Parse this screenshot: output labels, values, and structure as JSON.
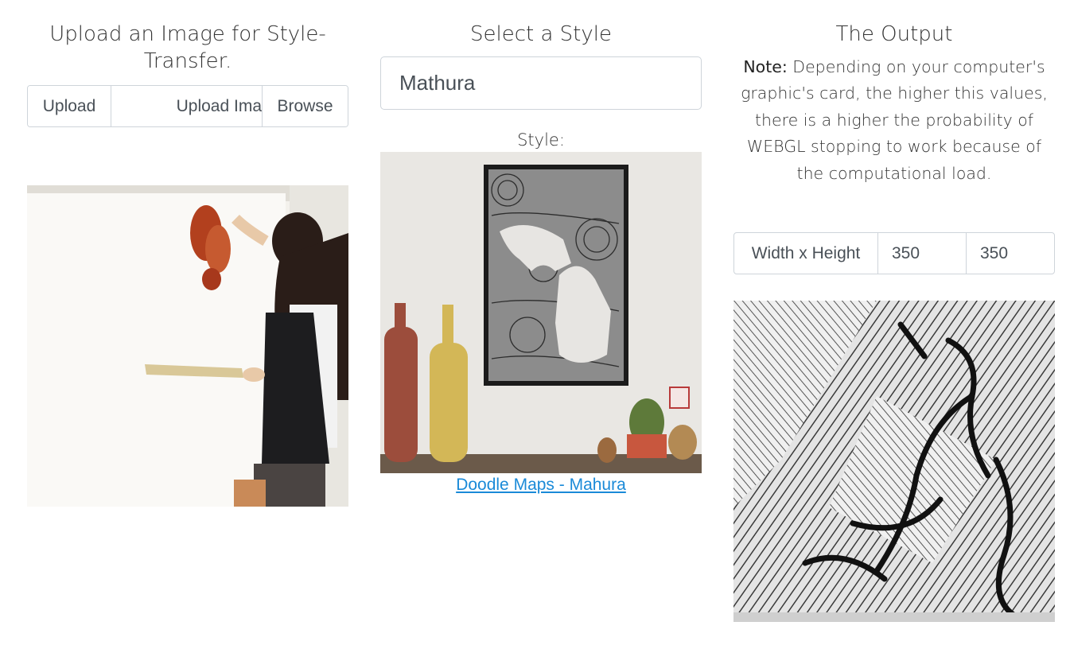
{
  "upload_column": {
    "title": "Upload an Image for Style-Transfer.",
    "prefix_label": "Upload",
    "file_placeholder": "Upload Ima",
    "browse_label": "Browse",
    "image_icon": "woman-painting-photo"
  },
  "style_column": {
    "title": "Select a Style",
    "selected_style": "Mathura",
    "style_label": "Style:",
    "style_image_icon": "doodle-map-photo",
    "link_text": "Doodle Maps - Mahura"
  },
  "output_column": {
    "title": "The Output",
    "note_bold": "Note:",
    "note_text": " Depending on your computer's graphic's card, the higher this values, there is a higher the probability of WEBGL stopping to work because of the computational load.",
    "size_label": "Width x Height",
    "width_value": "350",
    "height_value": "350",
    "output_image_icon": "stylized-output-image"
  },
  "colors": {
    "link": "#1a8ad8",
    "border": "#ced4da"
  }
}
